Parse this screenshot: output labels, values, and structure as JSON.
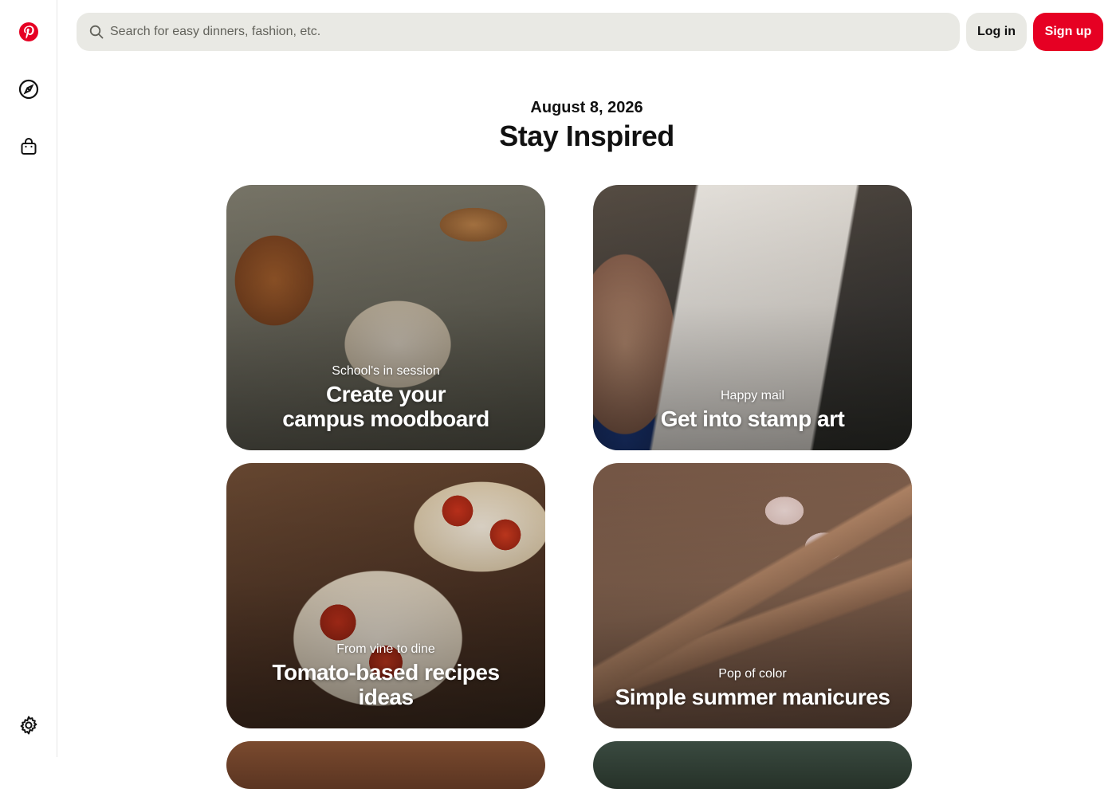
{
  "sidebar": {
    "items": [
      {
        "icon": "pinterest-logo-icon",
        "color": "#e60023"
      },
      {
        "icon": "compass-icon"
      },
      {
        "icon": "shopping-bag-icon"
      },
      {
        "icon": "gear-icon"
      }
    ]
  },
  "header": {
    "search_placeholder": "Search for easy dinners, fashion, etc.",
    "login_label": "Log in",
    "signup_label": "Sign up",
    "brand_color": "#e60023"
  },
  "main": {
    "date": "August 8, 2026",
    "title": "Stay Inspired",
    "cards": [
      {
        "subtitle": "School's in session",
        "title": "Create your campus moodboard"
      },
      {
        "subtitle": "Happy mail",
        "title": "Get into stamp art"
      },
      {
        "subtitle": "From vine to dine",
        "title": "Tomato-based recipes ideas"
      },
      {
        "subtitle": "Pop of color",
        "title": "Simple summer manicures"
      }
    ]
  }
}
